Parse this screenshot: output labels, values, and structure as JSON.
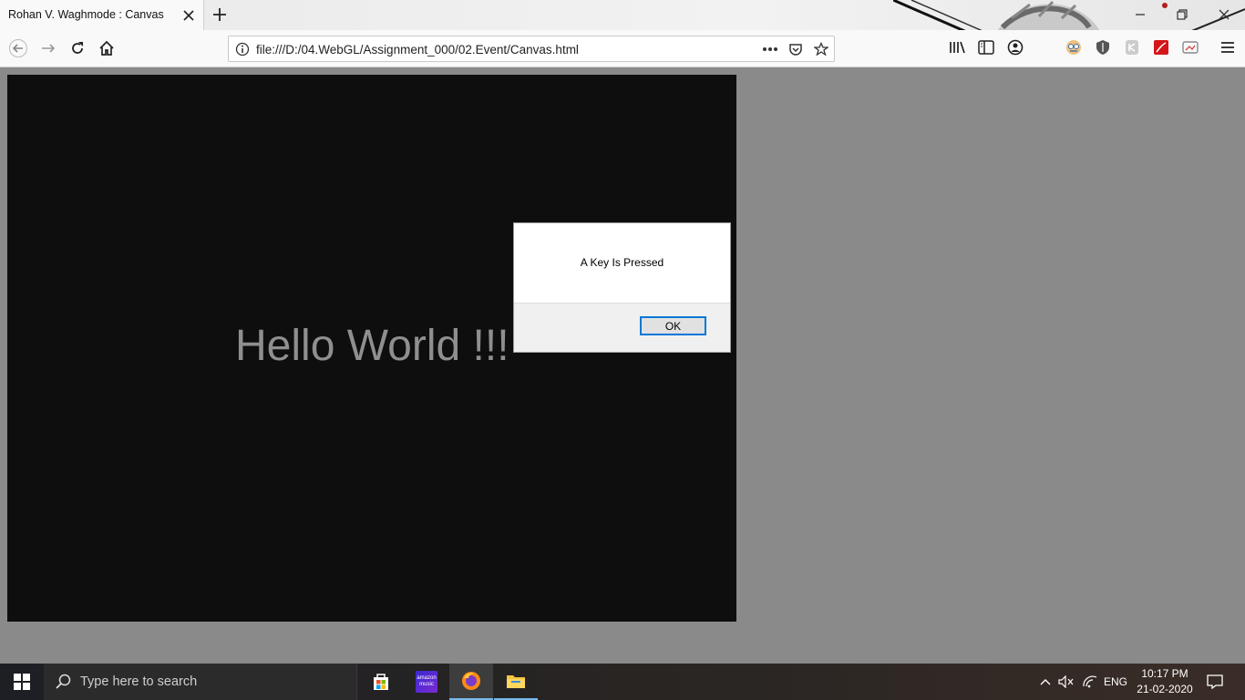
{
  "browser": {
    "tab": {
      "title": "Rohan V. Waghmode : Canvas"
    },
    "url": "file:///D:/04.WebGL/Assignment_000/02.Event/Canvas.html"
  },
  "canvas": {
    "text": "Hello World !!!"
  },
  "dialog": {
    "message": "A Key Is Pressed",
    "ok_label": "OK"
  },
  "taskbar": {
    "search_placeholder": "Type here to search",
    "apps": [
      "microsoft-store",
      "amazon-music",
      "firefox",
      "file-explorer"
    ],
    "amazon_music_label_1": "amazon",
    "amazon_music_label_2": "music",
    "language": "ENG",
    "time": "10:17 PM",
    "date": "21-02-2020"
  },
  "colors": {
    "canvas_bg": "#0e0e0e",
    "page_bg": "#8a8a8a",
    "dialog_accent": "#0078d7"
  }
}
